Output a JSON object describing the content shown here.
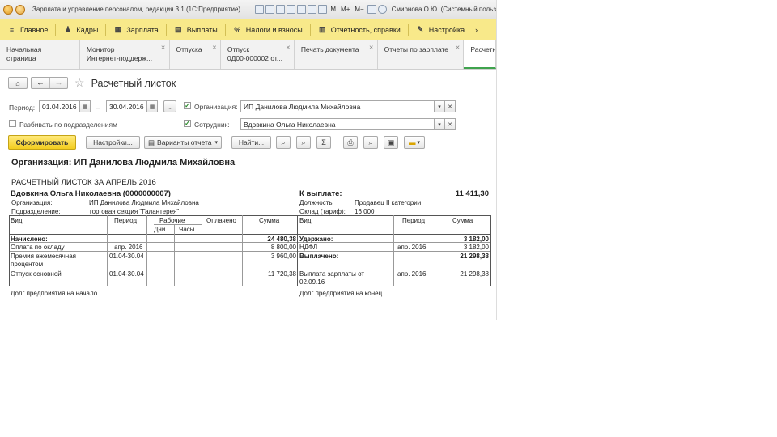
{
  "window": {
    "title": "Зарплата и управление персоналом, редакция 3.1  (1С:Предприятие)",
    "toolbar_texts": [
      "M",
      "M+",
      "M−"
    ],
    "user": "Смирнова О.Ю. (Системный польз"
  },
  "sections": [
    {
      "label": "Главное",
      "icon": "≡"
    },
    {
      "label": "Кадры",
      "icon": "♟"
    },
    {
      "label": "Зарплата",
      "icon": "▦"
    },
    {
      "label": "Выплаты",
      "icon": "▤"
    },
    {
      "label": "Налоги и взносы",
      "icon": "%"
    },
    {
      "label": "Отчетность, справки",
      "icon": "▥"
    },
    {
      "label": "Настройка",
      "icon": "✎"
    }
  ],
  "tabs": [
    {
      "line1": "Начальная страница",
      "line2": ""
    },
    {
      "line1": "Монитор",
      "line2": "Интернет-поддерж..."
    },
    {
      "line1": "Отпуска",
      "line2": ""
    },
    {
      "line1": "Отпуск",
      "line2": "0Д00-000002 от..."
    },
    {
      "line1": "Печать документа",
      "line2": ""
    },
    {
      "line1": "Отчеты по зарплате",
      "line2": ""
    },
    {
      "line1": "Расчетный л",
      "line2": ""
    }
  ],
  "form": {
    "title": "Расчетный листок",
    "period_label": "Период:",
    "period_from": "01.04.2016",
    "period_dash": "–",
    "period_to": "30.04.2016",
    "period_more": "...",
    "split_label": "Разбивать по подразделениям",
    "org_label": "Организация:",
    "org_value": "ИП Данилова Людмила Михайловна",
    "emp_label": "Сотрудник:",
    "emp_value": "Вдовкина Ольга Николаевна"
  },
  "toolbar": {
    "generate": "Сформировать",
    "settings": "Настройки...",
    "variants": "Варианты отчета",
    "find": "Найти..."
  },
  "report": {
    "org_heading": "Организация: ИП Данилова Людмила Михайловна",
    "title": "РАСЧЕТНЫЙ ЛИСТОК ЗА АПРЕЛЬ 2016",
    "employee": "Вдовкина Ольга Николаевна (0000000007)",
    "org_label": "Организация:",
    "org_value": "ИП Данилова Людмила Михайловна",
    "dept_label": "Подразделение:",
    "dept_value": "торговая секция \"Галантерея\"",
    "to_pay_label": "К выплате:",
    "to_pay_value": "11 411,30",
    "position_label": "Должность:",
    "position_value": "Продавец II категории",
    "salary_label": "Оклад (тариф):",
    "salary_value": "16 000",
    "headers_left": {
      "vid": "Вид",
      "period": "Период",
      "work": "Рабочие",
      "days": "Дни",
      "hours": "Часы",
      "paid": "Оплачено",
      "sum": "Сумма"
    },
    "headers_right": {
      "vid": "Вид",
      "period": "Период",
      "sum": "Сумма"
    },
    "accrued_label": "Начислено:",
    "accrued_total": "24 480,38",
    "withheld_label": "Удержано:",
    "withheld_total": "3 182,00",
    "left_rows": [
      {
        "vid": "Оплата по окладу",
        "period": "апр. 2016",
        "sum": "8 800,00"
      },
      {
        "vid": "Премия ежемесячная процентом",
        "period": "01.04-30.04",
        "sum": "3 960,00"
      },
      {
        "vid": "Отпуск основной",
        "period": "01.04-30.04",
        "sum": "11 720,38"
      }
    ],
    "right_rows": [
      {
        "vid": "НДФЛ",
        "period": "апр. 2016",
        "sum": "3 182,00"
      }
    ],
    "paid_label": "Выплачено:",
    "paid_total": "21 298,38",
    "paid_rows": [
      {
        "vid": "Выплата зарплаты  от 02.09.16",
        "period": "апр. 2016",
        "sum": "21 298,38"
      }
    ],
    "debt_start": "Долг предприятия на начало",
    "debt_end": "Долг предприятия на конец"
  }
}
